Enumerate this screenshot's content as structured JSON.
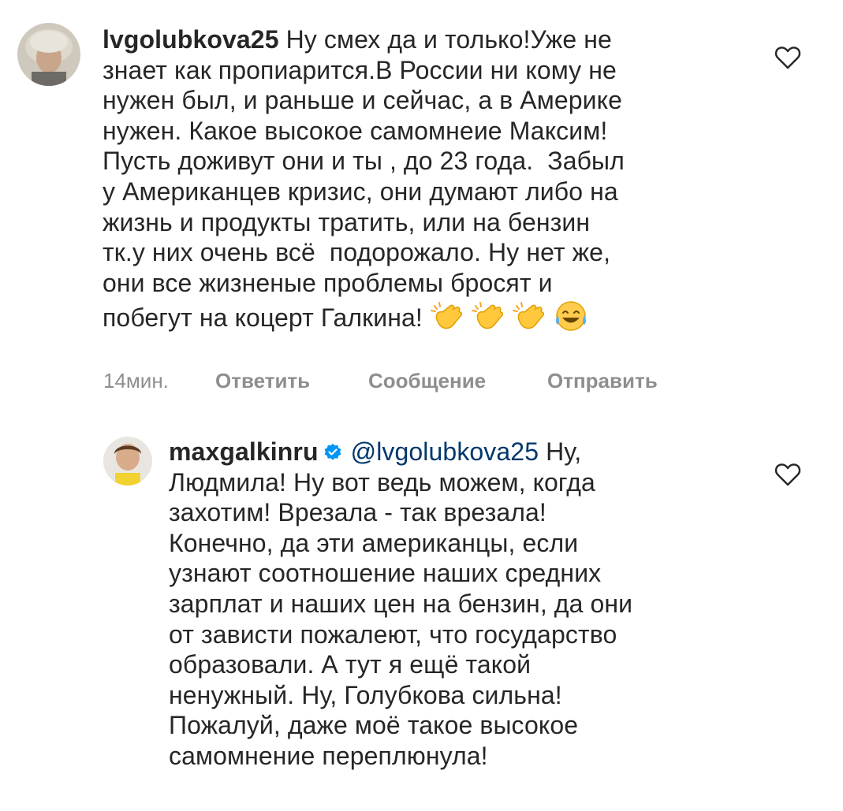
{
  "comment1": {
    "username": "lvgolubkova25",
    "lines": [
      " Ну смех да и только!Уже не",
      "знает как пропиарится.В России ни кому не",
      "нужен был, и раньше и сейчас, а в Америке",
      "нужен. Какое высокое самомнеие Максим!",
      "Пусть доживут они и ты , до 23 года.  Забыл",
      "у Американцев кризис, они думают либо на",
      "жизнь и продукты тратить, или на бензин",
      "тк.у них очень всё  подорожало. Ну нет же,",
      "они все жизненые проблемы бросят и",
      "побегут на коцерт Галкина! "
    ],
    "emojis": [
      "clapping-hands",
      "clapping-hands",
      "clapping-hands",
      "face-with-tears-of-joy"
    ],
    "time": "14мин.",
    "reply_label": "Ответить",
    "message_label": "Сообщение",
    "send_label": "Отправить"
  },
  "comment2": {
    "username": "maxgalkinru",
    "verified": true,
    "mention": "@lvgolubkova25",
    "first_line_rest": " Ну,",
    "lines": [
      "Людмила! Ну вот ведь можем, когда",
      "захотим! Врезала - так врезала!",
      "Конечно, да эти американцы, если",
      "узнают соотношение наших средних",
      "зарплат и наших цен на бензин, да они",
      "от зависти пожалеют, что государство",
      "образовали. А тут я ещё такой",
      "ненужный. Ну, Голубкова сильна!",
      "Пожалуй, даже моё такое высокое",
      "самомнение переплюнула!"
    ]
  },
  "colors": {
    "text": "#262626",
    "secondary": "#8e8e8e",
    "mention": "#00376b",
    "verified": "#0095f6"
  },
  "icons": [
    "heart-outline-icon",
    "verified-badge-icon"
  ]
}
